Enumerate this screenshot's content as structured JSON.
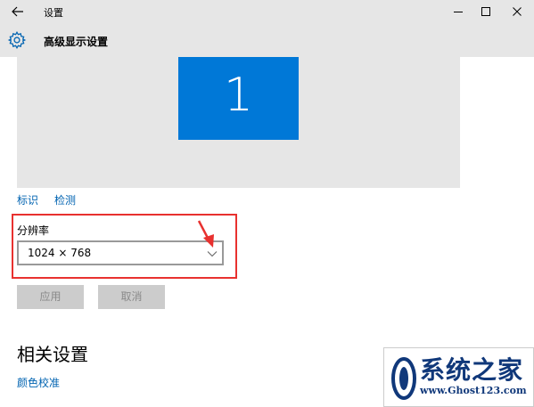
{
  "window": {
    "title": "设置",
    "back_icon": "back-arrow-icon",
    "minimize_icon": "minimize-icon",
    "maximize_icon": "maximize-icon",
    "close_icon": "close-icon"
  },
  "header": {
    "icon": "gear-icon",
    "title": "高级显示设置"
  },
  "preview": {
    "monitor_number": "1",
    "monitor_color": "#0078d7"
  },
  "links": {
    "identify": "标识",
    "detect": "检测"
  },
  "resolution": {
    "label": "分辨率",
    "value": "1024 × 768",
    "dropdown_icon": "chevron-down-icon",
    "highlight_color": "#e8312f"
  },
  "buttons": {
    "apply": "应用",
    "cancel": "取消"
  },
  "related": {
    "title": "相关设置",
    "color_calibration": "颜色校准"
  },
  "watermark": {
    "name": "系统之家",
    "url": "www.Ghost123.com"
  },
  "colors": {
    "accent": "#0078d7",
    "link": "#0063b1",
    "annotation": "#e8312f"
  }
}
